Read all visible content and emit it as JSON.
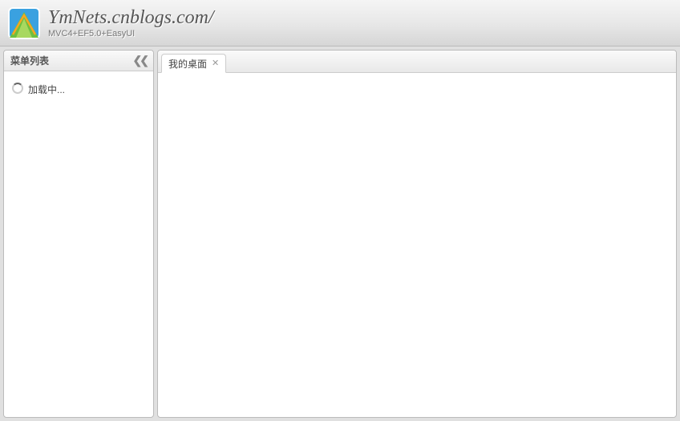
{
  "header": {
    "title": "YmNets.cnblogs.com/",
    "subtitle": "MVC4+EF5.0+EasyUI"
  },
  "sidebar": {
    "title": "菜单列表",
    "loading_text": "加载中..."
  },
  "tabs": [
    {
      "label": "我的桌面",
      "closable": true,
      "active": true
    }
  ]
}
